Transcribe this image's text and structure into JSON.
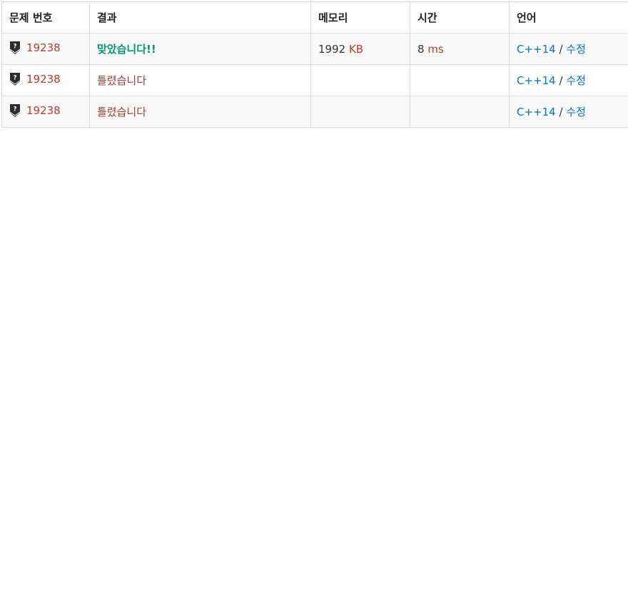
{
  "table": {
    "headers": {
      "problem": "문제 번호",
      "result": "결과",
      "memory": "메모리",
      "time": "시간",
      "language": "언어"
    },
    "rows": [
      {
        "problem": "19238",
        "result": "맞았습니다!!",
        "memory_value": "1992",
        "memory_unit": "KB",
        "time_value": "8",
        "time_unit": "ms",
        "language": "C++14",
        "separator": "/",
        "edit": "수정"
      },
      {
        "problem": "19238",
        "result": "틀렸습니다",
        "memory_value": "",
        "memory_unit": "",
        "time_value": "",
        "time_unit": "",
        "language": "C++14",
        "separator": "/",
        "edit": "수정"
      },
      {
        "problem": "19238",
        "result": "틀렸습니다",
        "memory_value": "",
        "memory_unit": "",
        "time_value": "",
        "time_unit": "",
        "language": "C++14",
        "separator": "/",
        "edit": "수정"
      }
    ]
  },
  "colors": {
    "accepted": "#009874",
    "wrong": "#b03a2e",
    "problem_link": "#c0392b",
    "unit": "#c0392b",
    "language_link": "#0076c0",
    "border": "#dddddd"
  },
  "icons": {
    "problem_tier": "unrated-tier-icon"
  }
}
